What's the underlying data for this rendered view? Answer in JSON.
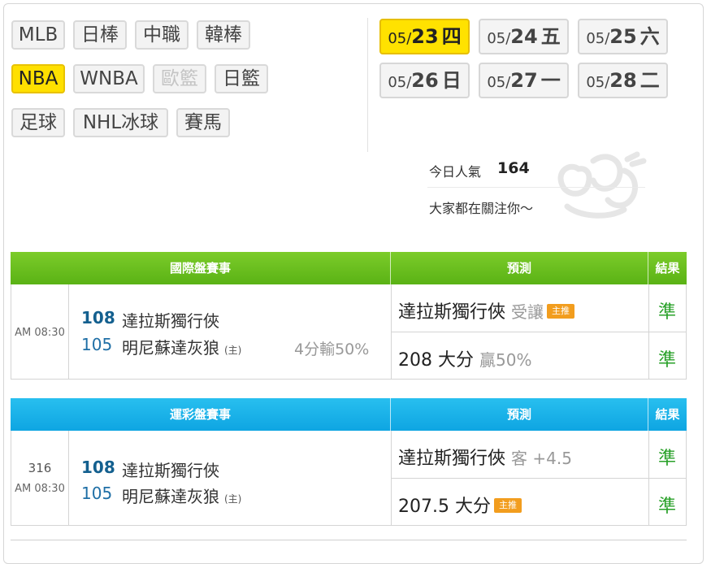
{
  "sports": {
    "mlb": "MLB",
    "npb": "日棒",
    "cpbl": "中職",
    "kbo": "韓棒",
    "nba": "NBA",
    "wnba": "WNBA",
    "euro": "歐籃",
    "jpbk": "日籃",
    "soccer": "足球",
    "nhl": "NHL冰球",
    "horse": "賽馬",
    "active": "NBA",
    "disabled": "歐籃"
  },
  "dates": [
    {
      "md": "05/",
      "d": "23",
      "wd": "四",
      "active": true
    },
    {
      "md": "05/",
      "d": "24",
      "wd": "五",
      "active": false
    },
    {
      "md": "05/",
      "d": "25",
      "wd": "六",
      "active": false
    },
    {
      "md": "05/",
      "d": "26",
      "wd": "日",
      "active": false
    },
    {
      "md": "05/",
      "d": "27",
      "wd": "一",
      "active": false
    },
    {
      "md": "05/",
      "d": "28",
      "wd": "二",
      "active": false
    }
  ],
  "popularity": {
    "label": "今日人氣",
    "count": "164",
    "message": "大家都在關注你～",
    "mascot_icon": "bear-mascot-icon"
  },
  "international": {
    "headers": {
      "event": "國際盤賽事",
      "prediction": "預測",
      "result": "結果"
    },
    "color": "#6cbf20",
    "game": {
      "time": "AM 08:30",
      "away_score": "108",
      "away_team": "達拉斯獨行俠",
      "home_score": "105",
      "home_team": "明尼蘇達灰狼",
      "home_tag": "(主)",
      "outcome": "4分輸50%"
    },
    "predictions": [
      {
        "main": "達拉斯獨行俠",
        "sub": "受讓",
        "badge": "主推",
        "result": "準"
      },
      {
        "main": "208 大分",
        "sub": "贏50%",
        "badge": "",
        "result": "準"
      }
    ]
  },
  "lottery": {
    "headers": {
      "event": "運彩盤賽事",
      "prediction": "預測",
      "result": "結果"
    },
    "color": "#19aee8",
    "game": {
      "number": "316",
      "time": "AM 08:30",
      "away_score": "108",
      "away_team": "達拉斯獨行俠",
      "home_score": "105",
      "home_team": "明尼蘇達灰狼",
      "home_tag": "(主)"
    },
    "predictions": [
      {
        "main": "達拉斯獨行俠",
        "sub": "客 +4.5",
        "badge": "",
        "result": "準"
      },
      {
        "main": "207.5 大分",
        "sub": "",
        "badge": "主推",
        "result": "準"
      }
    ]
  }
}
